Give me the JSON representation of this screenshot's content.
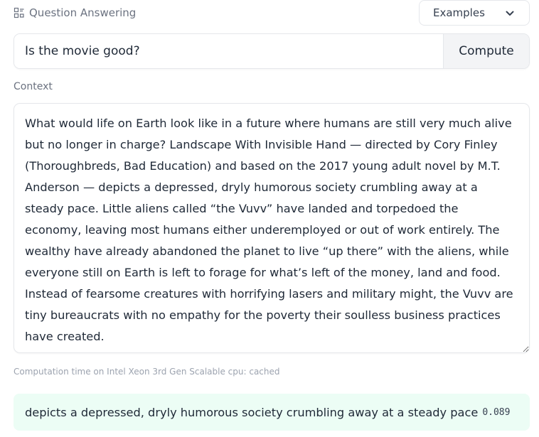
{
  "header": {
    "task_label": "Question Answering",
    "examples_label": "Examples"
  },
  "question": {
    "value": "Is the movie good?",
    "compute_label": "Compute"
  },
  "context": {
    "label": "Context",
    "text": "What would life on Earth look like in a future where humans are still very much alive but no longer in charge? Landscape With Invisible Hand — directed by Cory Finley (Thoroughbreds, Bad Education) and based on the 2017 young adult novel by M.T. Anderson — depicts a depressed, dryly humorous society crumbling away at a steady pace. Little aliens called “the Vuvv” have landed and torpedoed the economy, leaving most humans either underemployed or out of work entirely. The wealthy have already abandoned the planet to live “up there” with the aliens, while everyone still on Earth is left to forage for what’s left of the money, land and food. Instead of fearsome creatures with horrifying lasers and military might, the Vuvv are tiny bureaucrats with no empathy for the poverty their soulless business practices have created."
  },
  "computation": {
    "time_text": "Computation time on Intel Xeon 3rd Gen Scalable cpu: cached"
  },
  "answer": {
    "text": "depicts a depressed, dryly humorous society crumbling away at a steady pace",
    "score": "0.089"
  },
  "icons": {
    "task": "question-answering-icon",
    "dropdown": "chevron-down-icon",
    "resize": "resize-handle-icon"
  },
  "colors": {
    "answer_bg": "#ecfdf5",
    "button_bg": "#f3f4f6",
    "muted_text": "#6b7280"
  }
}
